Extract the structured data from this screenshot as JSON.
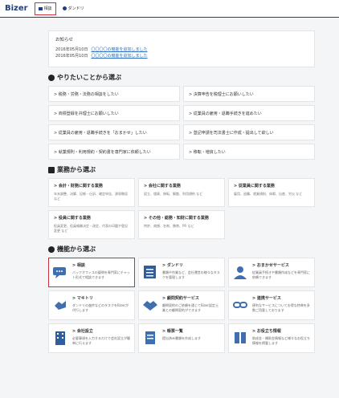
{
  "header": {
    "logo": "Bizer",
    "tabs": [
      {
        "label": "相談",
        "icon": "chat-icon"
      },
      {
        "label": "ダンドリ",
        "icon": "check-circle-icon"
      }
    ]
  },
  "notice": {
    "title": "お知らせ",
    "items": [
      {
        "date": "2016年05月10日",
        "text": "〇〇〇〇の機能を追加しました"
      },
      {
        "date": "2016年05月10日",
        "text": "〇〇〇〇の機能を追加しました"
      }
    ]
  },
  "sections": {
    "todo": "やりたいことから選ぶ",
    "business": "業務から選ぶ",
    "features": "機能から選ぶ"
  },
  "todo_items": [
    "> 税務・労務・法務の相談をしたい",
    "> 決算申告を税理士にお願いしたい",
    "> 商標登録を弁理士にお願いしたい",
    "> 従業員の雇用・退職手続きを進めたい",
    "> 従業員の雇用・退職手続きを「おまかせ」したい",
    "> 登記申請を司法書士に作成・提出して欲しい",
    "> 就業規則・利用規約・契約書を専門家に依頼したい",
    "> 移転・増資したい"
  ],
  "business_items": [
    {
      "title": "> 会計・財務に関する業務",
      "desc": "年末調整、決算、記帳・仕訳、確定申告、源泉徴収 など"
    },
    {
      "title": "> 会社に関する業務",
      "desc": "設立、増資、移転、解散、利用規約 など"
    },
    {
      "title": "> 従業員に関する業務",
      "desc": "雇用、退職、就業規則、休暇、出産、労災 など"
    },
    {
      "title": "> 役員に関する業務",
      "desc": "役員変更、役員報酬決定・改定、代表の印鑑や登記変更 など"
    },
    {
      "title": "> その他・総務・知財に関する業務",
      "desc": "特許、商標、名刺、携帯、PR など"
    }
  ],
  "feature_items": [
    {
      "title": "> 相談",
      "desc": "バックオフィスの疑問を専門家にチャット形式で相談できます",
      "icon": "chat-bubble-icon"
    },
    {
      "title": "> ダンドリ",
      "desc": "書類や作業など、会社運営の様々なタスクを管理します",
      "icon": "checklist-icon"
    },
    {
      "title": "> おまかせサービス",
      "desc": "従業員手続きや書類作成などを専門家に依頼できます",
      "icon": "person-icon"
    },
    {
      "title": "> マキトリ",
      "desc": "ダンドリの進捗などのタスクをBizerが代行します",
      "icon": "hand-icon"
    },
    {
      "title": "> 顧問契約サービス",
      "desc": "顧問契約のご依頼を通じてBizer認定士業との顧問契約ができます",
      "icon": "handshake-icon"
    },
    {
      "title": "> 連携サービス",
      "desc": "便利なサービスについてお得な特典を多数ご用意しております",
      "icon": "link-icon"
    },
    {
      "title": "> 会社設立",
      "desc": "必要事項を入力するだけで会社設立が簡単に行えます",
      "icon": "building-icon"
    },
    {
      "title": "> 帳票一覧",
      "desc": "提出済み書類を作成します",
      "icon": "document-icon"
    },
    {
      "title": "> お役立ち情報",
      "desc": "助成金・補助金情報など様々なお役立ち情報を掲載します",
      "icon": "book-icon"
    }
  ]
}
